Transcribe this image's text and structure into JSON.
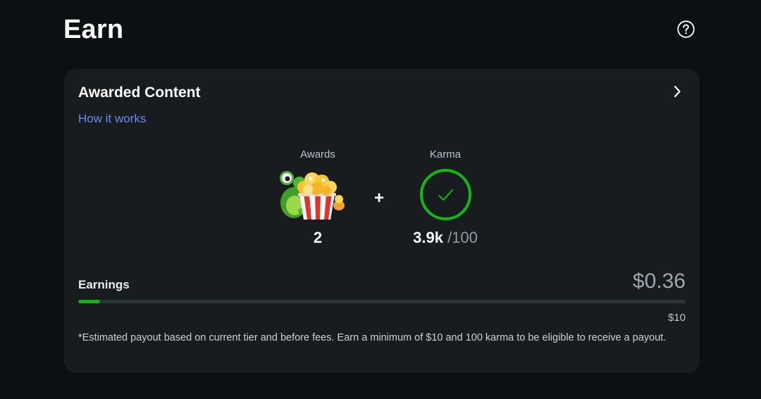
{
  "header": {
    "title": "Earn",
    "help_icon": "help-circle-icon"
  },
  "card": {
    "title": "Awarded Content",
    "chevron_icon": "chevron-right-icon",
    "how_it_works_label": "How it works",
    "awards": {
      "label": "Awards",
      "value": "2",
      "icon": "frog-popcorn-award-icon"
    },
    "plus": "+",
    "karma": {
      "label": "Karma",
      "value": "3.9k",
      "threshold": "/100",
      "icon": "check-circle-icon",
      "ring_color": "#13b713"
    },
    "earnings": {
      "label": "Earnings",
      "amount": "$0.36",
      "goal": "$10",
      "progress_fraction": 0.036,
      "bar_color": "#0fb40f"
    },
    "footnote": "*Estimated payout based on current tier and before fees. Earn a minimum of $10 and 100 karma to be eligible to receive a payout."
  }
}
